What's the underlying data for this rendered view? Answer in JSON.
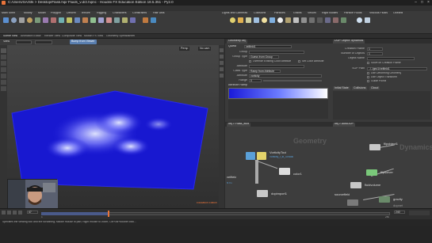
{
  "titlebar": {
    "title": "C:/Users/SA/Stk > Desktop/Flask.hip/ Fluids_v.d/2.hipnc - Houdini FX Education Edition 18.5.351 - Py2.0"
  },
  "menubar": {
    "items": [
      "File",
      "Edit",
      "Render",
      "Assets",
      "Windows",
      "Help",
      "Modo",
      "Build",
      "Main Shelf",
      "Modify",
      "Model",
      "Polygon",
      "Deform",
      "Texture",
      "Rigging",
      "Characters",
      "Constraints",
      "Hair Utils",
      "Guide Process",
      "Guide Brushes",
      "Terrain FX",
      "Simple FX",
      "Cloud FX",
      "Volume",
      "Create",
      "Lights and Cameras",
      "Collisions",
      "Particles",
      "Grains",
      "Vellum",
      "Rigid Bodies",
      "Particle Fluids",
      "Viscous Fluids",
      "Oceans",
      "Fluid Containers",
      "Populate Containers",
      "Container Tools",
      "Pyro FX",
      "Sparse Pyro FX",
      "FEM",
      "Wires",
      "Crowds",
      "Drive Simulation"
    ]
  },
  "pathbar": {
    "tabs": [
      "Scene View",
      "Animation Editor",
      "Render View",
      "Composite View",
      "Motion FX View",
      "Geometry Spreadsheet"
    ]
  },
  "viewport": {
    "tab": "View",
    "persp": "Persp",
    "cam": "No cam",
    "node_badge": "Bump from Viewer",
    "footer": "Education Edition"
  },
  "params": {
    "header": "Geometry obj",
    "node_type": "Quest",
    "node_name": "velfield1",
    "rows": [
      {
        "label": "Group",
        "value": ""
      },
      {
        "label": "Group Type",
        "value": "Guess from Group"
      },
      {
        "label": "Attribute",
        "value": ""
      },
      {
        "label": "Class Type",
        "value": "Ramp from Attribute"
      },
      {
        "label": "Attribute",
        "value": "vorticity"
      },
      {
        "label": "Range",
        "value": "0"
      }
    ],
    "checks": [
      "Override Existing Color Attribute",
      "Set Color Attribute"
    ],
    "ramp_label": "Attribute Ramp"
  },
  "spread": {
    "header": "DOP Object: dynamics",
    "rows": [
      {
        "label": "Creation Frame",
        "value": "1"
      },
      {
        "label": "Number of Objects",
        "value": "1"
      },
      {
        "label": "Object Name",
        "value": ""
      },
      {
        "label": "Solve on Creation Frame",
        "value": ""
      },
      {
        "label": "SOP Path",
        "value": "../../geo1/velfield1"
      }
    ],
    "checks": [
      "Use Deforming Geometry",
      "Use Object Transform",
      "Guide Points"
    ],
    "tabs": [
      "Initial State",
      "Collisions",
      "Cloud"
    ]
  },
  "netL": {
    "path": "obj > Flask_fluid",
    "label": "Geometry",
    "nodes": [
      {
        "name": "VorticityTool",
        "sub": "Vorticity_f_st_4.hdalc"
      },
      {
        "name": "velfield"
      },
      {
        "name": "color1"
      },
      {
        "name": "dopimport1"
      },
      {
        "name": "NTG"
      }
    ]
  },
  "netR": {
    "path": "obj > AutoDOP",
    "label": "Dynamics",
    "nodes": [
      {
        "name": "flipsolver"
      },
      {
        "name": "flipobject1"
      },
      {
        "name": "fluidvolume"
      },
      {
        "name": "sourcefield"
      },
      {
        "name": "gravity"
      },
      {
        "name": "dopnet"
      }
    ]
  },
  "timebar": {
    "frame": "47",
    "start": "1",
    "end": "240",
    "ticks": [
      "24",
      "48",
      "72",
      "96",
      "120",
      "144",
      "168",
      "192",
      "216",
      "240"
    ]
  },
  "statusbar": {
    "text": "Specifies the viewing tool and the scrubbing; Middle mouse to pan; Right mouse to zoom; Ctrl+Alt+double click…"
  },
  "colors": {
    "accent": "#e8743b",
    "volume_blue": "#1a1ad8",
    "node_yellow": "#e3d36a",
    "node_blue": "#5aa0d8"
  }
}
